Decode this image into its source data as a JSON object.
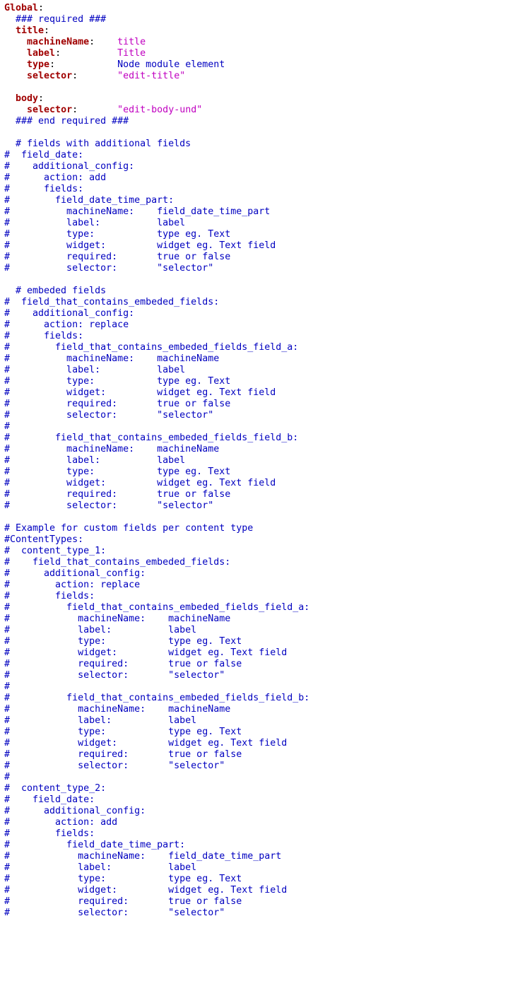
{
  "lines": [
    [
      [
        "k",
        "Global"
      ],
      [
        "p",
        ":"
      ]
    ],
    [
      [
        "c",
        "  ### required ###"
      ]
    ],
    [
      [
        "c",
        "  "
      ],
      [
        "k2",
        "title"
      ],
      [
        "p",
        ":"
      ]
    ],
    [
      [
        "c",
        "    "
      ],
      [
        "k2",
        "machineName"
      ],
      [
        "p",
        ":"
      ],
      [
        "c",
        "    "
      ],
      [
        "s",
        "title"
      ]
    ],
    [
      [
        "c",
        "    "
      ],
      [
        "k2",
        "label"
      ],
      [
        "p",
        ":"
      ],
      [
        "c",
        "          "
      ],
      [
        "s",
        "Title"
      ]
    ],
    [
      [
        "c",
        "    "
      ],
      [
        "k2",
        "type"
      ],
      [
        "p",
        ":"
      ],
      [
        "c",
        "           "
      ],
      [
        "v",
        "Node module element"
      ]
    ],
    [
      [
        "c",
        "    "
      ],
      [
        "k2",
        "selector"
      ],
      [
        "p",
        ":"
      ],
      [
        "c",
        "       "
      ],
      [
        "s",
        "\"edit-title\""
      ]
    ],
    [
      [
        "c",
        ""
      ]
    ],
    [
      [
        "c",
        "  "
      ],
      [
        "k2",
        "body"
      ],
      [
        "p",
        ":"
      ]
    ],
    [
      [
        "c",
        "    "
      ],
      [
        "k2",
        "selector"
      ],
      [
        "p",
        ":"
      ],
      [
        "c",
        "       "
      ],
      [
        "s",
        "\"edit-body-und\""
      ]
    ],
    [
      [
        "c",
        "  ### end required ###"
      ]
    ],
    [
      [
        "c",
        ""
      ]
    ],
    [
      [
        "c",
        "  # fields with additional fields"
      ]
    ],
    [
      [
        "c",
        "#  field_date:"
      ]
    ],
    [
      [
        "c",
        "#    additional_config:"
      ]
    ],
    [
      [
        "c",
        "#      action: add"
      ]
    ],
    [
      [
        "c",
        "#      fields:"
      ]
    ],
    [
      [
        "c",
        "#        field_date_time_part:"
      ]
    ],
    [
      [
        "c",
        "#          machineName:    field_date_time_part"
      ]
    ],
    [
      [
        "c",
        "#          label:          label"
      ]
    ],
    [
      [
        "c",
        "#          type:           type eg. Text"
      ]
    ],
    [
      [
        "c",
        "#          widget:         widget eg. Text field"
      ]
    ],
    [
      [
        "c",
        "#          required:       true or false"
      ]
    ],
    [
      [
        "c",
        "#          selector:       \"selector\""
      ]
    ],
    [
      [
        "c",
        ""
      ]
    ],
    [
      [
        "c",
        "  # embeded fields"
      ]
    ],
    [
      [
        "c",
        "#  field_that_contains_embeded_fields:"
      ]
    ],
    [
      [
        "c",
        "#    additional_config:"
      ]
    ],
    [
      [
        "c",
        "#      action: replace"
      ]
    ],
    [
      [
        "c",
        "#      fields:"
      ]
    ],
    [
      [
        "c",
        "#        field_that_contains_embeded_fields_field_a:"
      ]
    ],
    [
      [
        "c",
        "#          machineName:    machineName"
      ]
    ],
    [
      [
        "c",
        "#          label:          label"
      ]
    ],
    [
      [
        "c",
        "#          type:           type eg. Text"
      ]
    ],
    [
      [
        "c",
        "#          widget:         widget eg. Text field"
      ]
    ],
    [
      [
        "c",
        "#          required:       true or false"
      ]
    ],
    [
      [
        "c",
        "#          selector:       \"selector\""
      ]
    ],
    [
      [
        "c",
        "#"
      ]
    ],
    [
      [
        "c",
        "#        field_that_contains_embeded_fields_field_b:"
      ]
    ],
    [
      [
        "c",
        "#          machineName:    machineName"
      ]
    ],
    [
      [
        "c",
        "#          label:          label"
      ]
    ],
    [
      [
        "c",
        "#          type:           type eg. Text"
      ]
    ],
    [
      [
        "c",
        "#          widget:         widget eg. Text field"
      ]
    ],
    [
      [
        "c",
        "#          required:       true or false"
      ]
    ],
    [
      [
        "c",
        "#          selector:       \"selector\""
      ]
    ],
    [
      [
        "c",
        ""
      ]
    ],
    [
      [
        "c",
        "# Example for custom fields per content type"
      ]
    ],
    [
      [
        "c",
        "#ContentTypes:"
      ]
    ],
    [
      [
        "c",
        "#  content_type_1:"
      ]
    ],
    [
      [
        "c",
        "#    field_that_contains_embeded_fields:"
      ]
    ],
    [
      [
        "c",
        "#      additional_config:"
      ]
    ],
    [
      [
        "c",
        "#        action: replace"
      ]
    ],
    [
      [
        "c",
        "#        fields:"
      ]
    ],
    [
      [
        "c",
        "#          field_that_contains_embeded_fields_field_a:"
      ]
    ],
    [
      [
        "c",
        "#            machineName:    machineName"
      ]
    ],
    [
      [
        "c",
        "#            label:          label"
      ]
    ],
    [
      [
        "c",
        "#            type:           type eg. Text"
      ]
    ],
    [
      [
        "c",
        "#            widget:         widget eg. Text field"
      ]
    ],
    [
      [
        "c",
        "#            required:       true or false"
      ]
    ],
    [
      [
        "c",
        "#            selector:       \"selector\""
      ]
    ],
    [
      [
        "c",
        "#"
      ]
    ],
    [
      [
        "c",
        "#          field_that_contains_embeded_fields_field_b:"
      ]
    ],
    [
      [
        "c",
        "#            machineName:    machineName"
      ]
    ],
    [
      [
        "c",
        "#            label:          label"
      ]
    ],
    [
      [
        "c",
        "#            type:           type eg. Text"
      ]
    ],
    [
      [
        "c",
        "#            widget:         widget eg. Text field"
      ]
    ],
    [
      [
        "c",
        "#            required:       true or false"
      ]
    ],
    [
      [
        "c",
        "#            selector:       \"selector\""
      ]
    ],
    [
      [
        "c",
        "#"
      ]
    ],
    [
      [
        "c",
        "#  content_type_2:"
      ]
    ],
    [
      [
        "c",
        "#    field_date:"
      ]
    ],
    [
      [
        "c",
        "#      additional_config:"
      ]
    ],
    [
      [
        "c",
        "#        action: add"
      ]
    ],
    [
      [
        "c",
        "#        fields:"
      ]
    ],
    [
      [
        "c",
        "#          field_date_time_part:"
      ]
    ],
    [
      [
        "c",
        "#            machineName:    field_date_time_part"
      ]
    ],
    [
      [
        "c",
        "#            label:          label"
      ]
    ],
    [
      [
        "c",
        "#            type:           type eg. Text"
      ]
    ],
    [
      [
        "c",
        "#            widget:         widget eg. Text field"
      ]
    ],
    [
      [
        "c",
        "#            required:       true or false"
      ]
    ],
    [
      [
        "c",
        "#            selector:       \"selector\""
      ]
    ]
  ]
}
